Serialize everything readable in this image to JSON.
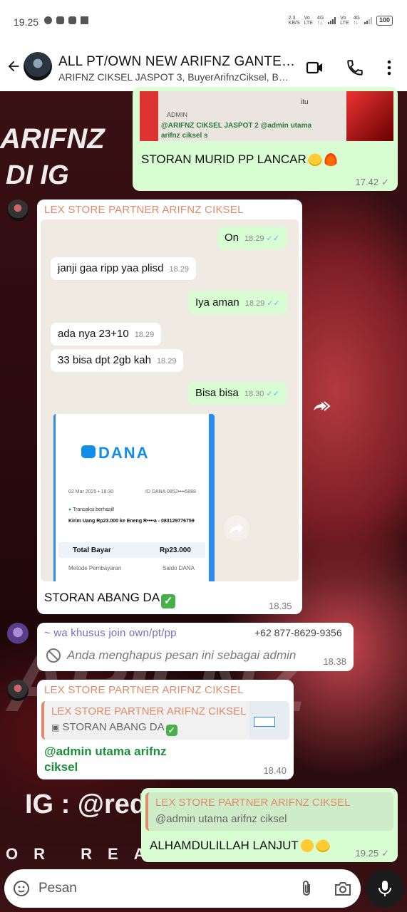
{
  "status_bar": {
    "time": "19.25",
    "battery": "100",
    "network": [
      "2.3",
      "Vo LTE",
      "4G",
      "Vo LTE",
      "4G"
    ]
  },
  "header": {
    "title": "ALL PT/OWN NEW ARIFNZ GANTENG...",
    "subtitle": "ARIFNZ CIKSEL JASPOT 3, BuyerArifnzCiksel, Buyer..."
  },
  "wallpaper": {
    "text1": "ARIFNZ",
    "text2": "DI IG",
    "text3": "IG : @red",
    "text4": "OR REA"
  },
  "messages": {
    "m1": {
      "quoted_admin": "ADMIN",
      "quoted_preview": "@ARIFNZ CIKSEL JASPOT 2 @admin utama arifnz ciksel s",
      "quoted_itu": "itu",
      "text": "STORAN MURID PP LANCAR",
      "time": "17.42"
    },
    "m2": {
      "sender": "LEX STORE PARTNER ARIFNZ CIKSEL",
      "caption": "STORAN ABANG DA",
      "time": "18.35",
      "screenshot": {
        "chat": [
          {
            "text": "On",
            "time": "18.29",
            "dir": "out"
          },
          {
            "text": "janji gaa ripp yaa plisd",
            "time": "18.29",
            "dir": "in"
          },
          {
            "text": "Iya aman",
            "time": "18.29",
            "dir": "out"
          },
          {
            "text": "ada nya 23+10",
            "time": "18.29",
            "dir": "in"
          },
          {
            "text": "33 bisa dpt 2gb kah",
            "time": "18.29",
            "dir": "in"
          },
          {
            "text": "Bisa bisa",
            "time": "18.30",
            "dir": "out"
          }
        ],
        "receipt": {
          "logo": "DANA",
          "date": "02 Mar 2025 • 18:30",
          "id": "ID DANA 0852••••5888",
          "status": "Transaksi berhasil!",
          "desc": "Kirim Uang Rp23.000 ke Eneng R••••a - 083129776759",
          "total_label": "Total Bayar",
          "total_value": "Rp23.000",
          "method_label": "Metode Pembayaran",
          "method_value": "Saldo DANA"
        }
      }
    },
    "m3": {
      "sender": "~ wa khusus join own/pt/pp",
      "phone": "+62 877-8629-9356",
      "text": "Anda menghapus pesan ini sebagai admin",
      "time": "18.38"
    },
    "m4": {
      "sender": "LEX STORE PARTNER ARIFNZ CIKSEL",
      "quote_title": "LEX STORE PARTNER ARIFNZ CIKSEL",
      "quote_body": "STORAN ABANG DA",
      "mention_line1": "@admin utama arifnz",
      "mention_line2": "ciksel",
      "time": "18.40"
    },
    "m5": {
      "quote_title": "LEX STORE PARTNER ARIFNZ CIKSEL",
      "quote_body": "@admin utama arifnz ciksel",
      "text": "ALHAMDULILLAH LANJUT",
      "time": "19.25"
    }
  },
  "composer": {
    "placeholder": "Pesan"
  },
  "colors": {
    "outgoing": "#d9fdd3",
    "incoming": "#ffffff",
    "sender": "#e08a6b",
    "read_tick": "#53bdeb",
    "mention": "#1a8f3a"
  }
}
